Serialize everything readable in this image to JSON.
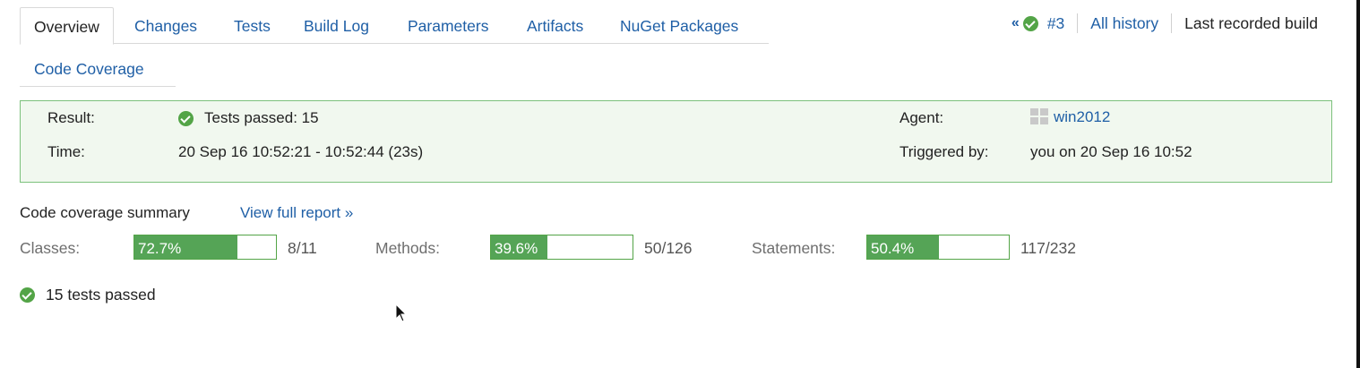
{
  "tabs": [
    "Overview",
    "Changes",
    "Tests",
    "Build Log",
    "Parameters",
    "Artifacts",
    "NuGet Packages"
  ],
  "tabs_row2": [
    "Code Coverage"
  ],
  "history": {
    "prev_glyph": "«",
    "build_number": "#3",
    "all_history": "All history",
    "last_recorded": "Last recorded build"
  },
  "info": {
    "result_label": "Result:",
    "result_value": "Tests passed: 15",
    "time_label": "Time:",
    "time_value": "20 Sep 16 10:52:21 - 10:52:44 (23s)",
    "agent_label": "Agent:",
    "agent_value": "win2012",
    "triggered_label": "Triggered by:",
    "triggered_value": "you on 20 Sep 16 10:52"
  },
  "coverage": {
    "title": "Code coverage summary",
    "link": "View full report »",
    "metrics": [
      {
        "label": "Classes:",
        "percent": "72.7%",
        "fraction": 0.727,
        "count": "8/11"
      },
      {
        "label": "Methods:",
        "percent": "39.6%",
        "fraction": 0.396,
        "count": "50/126"
      },
      {
        "label": "Statements:",
        "percent": "50.4%",
        "fraction": 0.504,
        "count": "117/232"
      }
    ]
  },
  "tests_summary": "15 tests passed",
  "colors": {
    "link": "#1f5fa6",
    "success": "#53a447",
    "info_bg": "#f1f8ef",
    "info_border": "#7cc17c"
  },
  "icons": {
    "status": "check-circle-icon",
    "agent": "windows-icon",
    "prev": "double-chevron-left-icon"
  }
}
